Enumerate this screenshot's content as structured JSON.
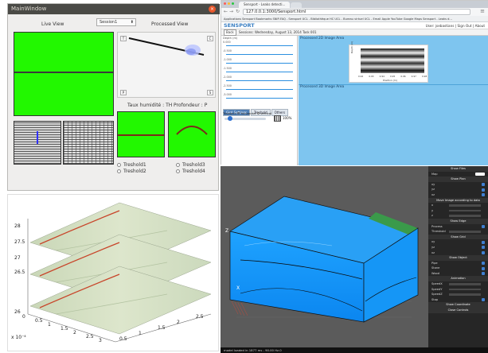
{
  "qt_window": {
    "title": "MainWindow",
    "close_glyph": "×",
    "live_view_label": "Live View",
    "processed_view_label": "Processed View",
    "session_select": "Session1",
    "taux_label": "Taux humidité : TH",
    "profondeur_label": "Profondeur : P",
    "btn_t": "T",
    "btn_c": "C",
    "btn_p": "P",
    "btn_s": "S",
    "thresholds": [
      "Treshold1",
      "Treshold3",
      "Treshold2",
      "Treshold4"
    ],
    "colors": {
      "green": "#22f800",
      "window_bg": "#efeeed",
      "titlebar": "#4a4a46"
    }
  },
  "browser": {
    "tab_title": "Sensport - Leaks detecti...",
    "url": "127.0.0.1:3000/Sensport.html",
    "bookmarks": "Applications  Sensport  Bookmarks  SNIP-FAQ - Sensport  UCL - Bibliothèque  HC UCL - Bureau virtuel  UCL - Email  Apple  YouTube  Google Maps  Sensport - Leaks d...",
    "brand": "SENSPORT",
    "user_links": "User: jsebastians  |  Sign Out  |  About",
    "back_label": "Back",
    "session_text": "Sessions:  Wednesday, August 13, 2014 Task 001",
    "left_axis_label": "Depth (m)",
    "left_ticks": [
      "0.000",
      "-0.500",
      "-1.000",
      "-1.500",
      "-2.000",
      "-2.500",
      "-3.000"
    ],
    "tabs": [
      "Gird Settings",
      "Treshold",
      "Others"
    ],
    "transect_label": "Transect:",
    "transect_options": [
      "horizontal",
      "vertical"
    ],
    "zoom_value": "100%",
    "processed_2d_title": "Processed 2D Image Area",
    "processed_3d_title": "Processed 3D Image Area",
    "plot_xlabel": "Position (m)",
    "plot_ylabel": "Depth (m)",
    "plot_xticks": [
      "0.92",
      "0.93",
      "0.94",
      "0.95",
      "0.96",
      "0.97",
      "0.98"
    ],
    "colors": {
      "accent": "#3a7fc3",
      "panel_blue": "#7ec5ef"
    }
  },
  "slices_plot": {
    "z_ticks": [
      "28",
      "27.5",
      "27",
      "26.5",
      "26"
    ],
    "y_ticks": [
      "0",
      "0.5",
      "1",
      "1.5",
      "2",
      "2.5",
      "3"
    ],
    "x_ticks": [
      "0.5",
      "1",
      "1.5",
      "2",
      "2.5"
    ],
    "y_exponent": "x 10⁻⁴"
  },
  "volume_view": {
    "axis_z": "Z",
    "axis_x": "X",
    "controls": [
      {
        "label": "Show Files",
        "kind": "head"
      },
      {
        "label": "Map",
        "kind": "toggle"
      },
      {
        "label": "Show Plan",
        "kind": "head"
      },
      {
        "label": "xy",
        "kind": "check"
      },
      {
        "label": "yz",
        "kind": "check"
      },
      {
        "label": "xz",
        "kind": "check"
      },
      {
        "label": "Move Image according to data",
        "kind": "head"
      },
      {
        "label": "x",
        "kind": "slider"
      },
      {
        "label": "y",
        "kind": "slider"
      },
      {
        "label": "z",
        "kind": "slider"
      },
      {
        "label": "Show Edge",
        "kind": "head"
      },
      {
        "label": "Process",
        "kind": "check"
      },
      {
        "label": "Threshold",
        "kind": "slider"
      },
      {
        "label": "Show Grid",
        "kind": "head"
      },
      {
        "label": "xy",
        "kind": "check"
      },
      {
        "label": "yz",
        "kind": "check"
      },
      {
        "label": "xz",
        "kind": "check"
      },
      {
        "label": "Show Object",
        "kind": "head"
      },
      {
        "label": "Pipe",
        "kind": "check"
      },
      {
        "label": "Stone",
        "kind": "check"
      },
      {
        "label": "Wood",
        "kind": "check"
      },
      {
        "label": "Animation",
        "kind": "head"
      },
      {
        "label": "SpeedX",
        "kind": "slider"
      },
      {
        "label": "SpeedY",
        "kind": "slider"
      },
      {
        "label": "SpeedZ",
        "kind": "slider"
      },
      {
        "label": "Stop",
        "kind": "check"
      },
      {
        "label": "Show Coordinate",
        "kind": "head"
      },
      {
        "label": "Close Controls",
        "kind": "head"
      }
    ],
    "status_text": "model loaded in 1877 ms - 90.00 Hz.0"
  }
}
